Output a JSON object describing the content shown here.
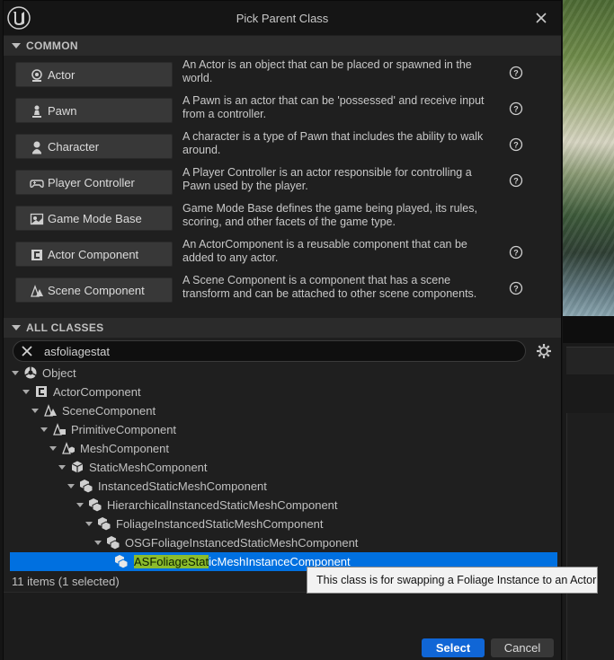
{
  "dialog": {
    "title": "Pick Parent Class"
  },
  "common": {
    "header": "COMMON",
    "rows": [
      {
        "label": "Actor",
        "icon": "actor-icon",
        "desc": "An Actor is an object that can be placed or spawned in the world."
      },
      {
        "label": "Pawn",
        "icon": "pawn-icon",
        "desc": "A Pawn is an actor that can be 'possessed' and receive input from a controller."
      },
      {
        "label": "Character",
        "icon": "character-icon",
        "desc": "A character is a type of Pawn that includes the ability to walk around."
      },
      {
        "label": "Player Controller",
        "icon": "gamepad-icon",
        "desc": "A Player Controller is an actor responsible for controlling a Pawn used by the player."
      },
      {
        "label": "Game Mode Base",
        "icon": "game-mode-icon",
        "desc": "Game Mode Base defines the game being played, its rules, scoring, and other facets of the game type."
      },
      {
        "label": "Actor Component",
        "icon": "actor-component-icon",
        "desc": "An ActorComponent is a reusable component that can be added to any actor."
      },
      {
        "label": "Scene Component",
        "icon": "scene-component-icon",
        "desc": "A Scene Component is a component that has a scene transform and can be attached to other scene components."
      }
    ]
  },
  "all_classes": {
    "header": "ALL CLASSES",
    "search_value": "asfoliagestat",
    "tree": [
      {
        "label": "Object",
        "icon": "object-icon"
      },
      {
        "label": "ActorComponent",
        "icon": "actor-component-icon"
      },
      {
        "label": "SceneComponent",
        "icon": "scene-component-icon"
      },
      {
        "label": "PrimitiveComponent",
        "icon": "primitive-component-icon"
      },
      {
        "label": "MeshComponent",
        "icon": "mesh-component-icon"
      },
      {
        "label": "StaticMeshComponent",
        "icon": "static-mesh-icon"
      },
      {
        "label": "InstancedStaticMeshComponent",
        "icon": "static-mesh-icon"
      },
      {
        "label": "HierarchicalInstancedStaticMeshComponent",
        "icon": "static-mesh-icon"
      },
      {
        "label": "FoliageInstancedStaticMeshComponent",
        "icon": "static-mesh-icon"
      },
      {
        "label": "OSGFoliageInstancedStaticMeshComponent",
        "icon": "static-mesh-icon"
      }
    ],
    "selected": {
      "match": "ASFoliageStat",
      "rest": "icMeshInstanceComponent",
      "icon": "static-mesh-icon"
    },
    "count": "11 items (1 selected)",
    "tooltip": "This class is for swapping a Foliage Instance to an Actor"
  },
  "buttons": {
    "select": "Select",
    "cancel": "Cancel"
  },
  "colors": {
    "accent": "#0070e0",
    "highlight": "#8cbc2c",
    "select_button": "#1066d6"
  }
}
